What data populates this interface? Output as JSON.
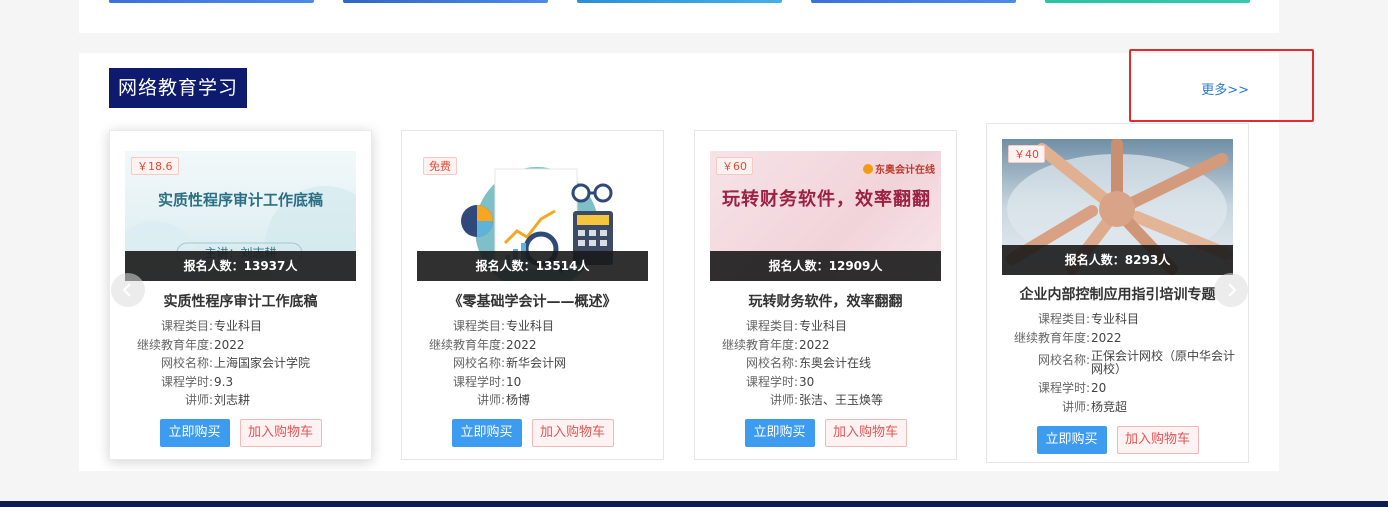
{
  "colors": {
    "title_bg": "#0e1a6e",
    "more_link": "#2a7ad5",
    "buy_button": "#3d9bf0",
    "cart_text": "#e25656",
    "highlight": "#e32b2b",
    "footer": "#0c1f4e"
  },
  "section": {
    "title": "网络教育学习",
    "more_label": "更多>>"
  },
  "carousel": {
    "prev_icon": "chevron-left-icon",
    "next_icon": "chevron-right-icon"
  },
  "labels": {
    "category": "课程类目:",
    "year": "继续教育年度:",
    "school": "网校名称:",
    "hours": "课程学时:",
    "teacher": "讲师:",
    "buy": "立即购买",
    "cart": "加入购物车"
  },
  "courses": [
    {
      "price": "￥18.6",
      "enroll": "报名人数：13937人",
      "thumb_title": "实质性程序审计工作底稿",
      "thumb_sub": "主讲：刘志耕",
      "title": "实质性程序审计工作底稿",
      "category": "专业科目",
      "year": "2022",
      "school": "上海国家会计学院",
      "hours": "9.3",
      "teacher": "刘志耕"
    },
    {
      "price": "免费",
      "enroll": "报名人数：13514人",
      "title": "《零基础学会计——概述》",
      "category": "专业科目",
      "year": "2022",
      "school": "新华会计网",
      "hours": "10",
      "teacher": "杨博"
    },
    {
      "price": "￥60",
      "enroll": "报名人数：12909人",
      "thumb_brand": "东奥会计在线",
      "thumb_title": "玩转财务软件，效率翻翻",
      "title": "玩转财务软件，效率翻翻",
      "category": "专业科目",
      "year": "2022",
      "school": "东奥会计在线",
      "hours": "30",
      "teacher": "张洁、王玉焕等"
    },
    {
      "price": "￥40",
      "enroll": "报名人数：8293人",
      "title": "企业内部控制应用指引培训专题",
      "category": "专业科目",
      "year": "2022",
      "school": "正保会计网校（原中华会计网校）",
      "hours": "20",
      "teacher": "杨竞超"
    }
  ]
}
